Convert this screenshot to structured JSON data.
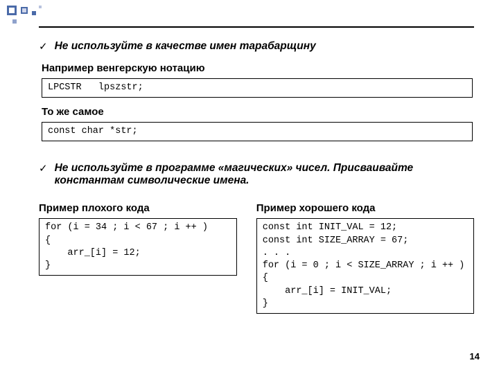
{
  "bullet1": "Не используйте в качестве имен тарабарщину",
  "sub_example_label": "Например венгерскую нотацию",
  "code1": "LPCSTR   lpszstr;",
  "sub_same_label": "То же самое",
  "code2": "const char *str;",
  "bullet2": "Не используйте в программе «магических» чисел. Присваивайте константам символические имена.",
  "bad_label": "Пример плохого кода",
  "good_label": "Пример хорошего кода",
  "code_bad": "for (i = 34 ; i < 67 ; i ++ )\n{\n    arr_[i] = 12;\n}",
  "code_good": "const int INIT_VAL = 12;\nconst int SIZE_ARRAY = 67;\n. . .\nfor (i = 0 ; i < SIZE_ARRAY ; i ++ )\n{\n    arr_[i] = INIT_VAL;\n}",
  "checkmark": "✓",
  "page": "14"
}
